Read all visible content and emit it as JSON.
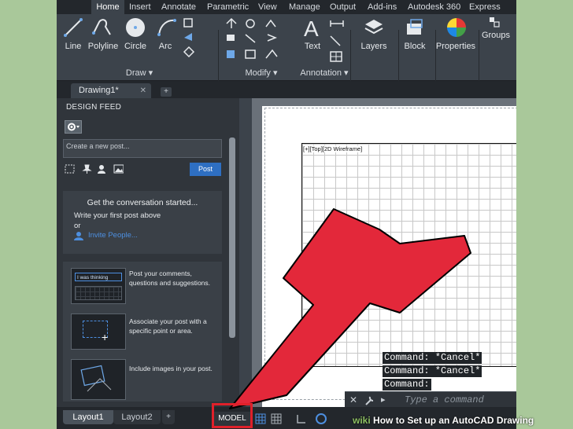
{
  "ribbon": {
    "tabs": [
      {
        "label": "Home",
        "active": true
      },
      {
        "label": "Insert"
      },
      {
        "label": "Annotate"
      },
      {
        "label": "Parametric"
      },
      {
        "label": "View"
      },
      {
        "label": "Manage"
      },
      {
        "label": "Output"
      },
      {
        "label": "Add-ins"
      },
      {
        "label": "Autodesk 360"
      },
      {
        "label": "Express Tools"
      }
    ],
    "tools": {
      "line": "Line",
      "polyline": "Polyline",
      "circle": "Circle",
      "arc": "Arc",
      "text": "Text",
      "layers": "Layers",
      "block": "Block",
      "properties": "Properties",
      "groups": "Groups"
    },
    "panels": {
      "draw": "Draw ▾",
      "modify": "Modify ▾",
      "annotation": "Annotation ▾"
    }
  },
  "document": {
    "tab_label": "Drawing1*",
    "close_symbol": "✕",
    "new_tab_symbol": "+"
  },
  "design_feed": {
    "title": "DESIGN FEED",
    "post_placeholder": "Create a new post...",
    "post_button": "Post",
    "conversation_title": "Get the conversation started...",
    "conversation_line1": "Write your first post above",
    "conversation_line2": "or",
    "invite_label": "Invite People...",
    "tips": [
      {
        "text": "Post your comments, questions and suggestions.",
        "thumb_text": "I was thinking"
      },
      {
        "text": "Associate your post with a specific point or area."
      },
      {
        "text": "Include images in your post."
      }
    ]
  },
  "viewport": {
    "label": "[+][Top][2D Wireframe]"
  },
  "command_line": {
    "history": [
      "Command: *Cancel*",
      "Command: *Cancel*",
      "Command:"
    ],
    "placeholder": "Type a command"
  },
  "status_bar": {
    "layout_tabs": [
      "Layout1",
      "Layout2"
    ],
    "add_layout": "+",
    "model_label": "MODEL"
  },
  "watermark": {
    "prefix": "wiki",
    "text": "How to Set up an AutoCAD Drawing"
  },
  "colors": {
    "highlight": "#e0202a",
    "ribbon_bg": "#3c434b",
    "accent_blue": "#2e6fc2"
  }
}
